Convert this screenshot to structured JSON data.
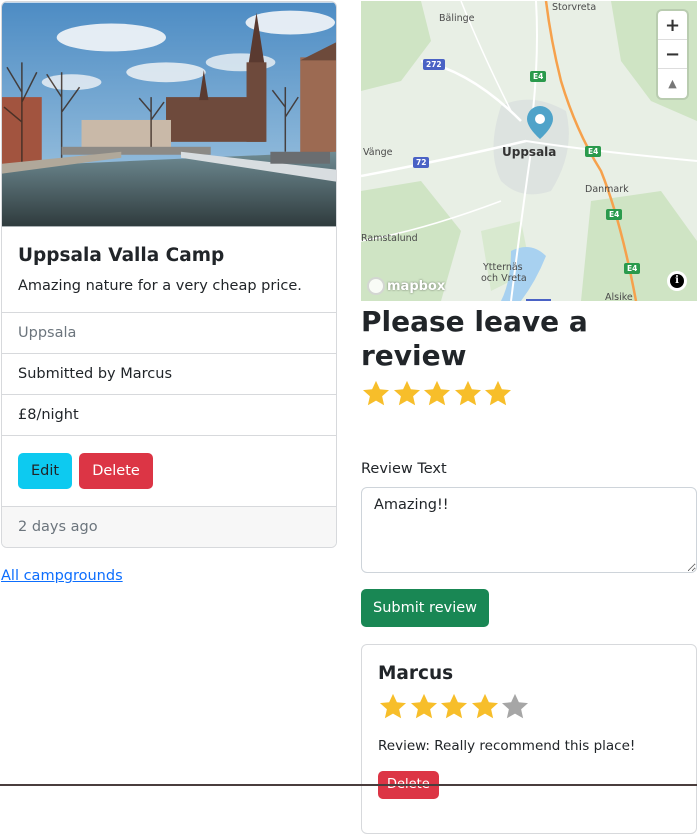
{
  "campground": {
    "title": "Uppsala Valla Camp",
    "description": "Amazing nature for a very cheap price.",
    "location": "Uppsala",
    "submitted_by": "Submitted by Marcus",
    "price": "£8/night",
    "edit_label": "Edit",
    "delete_label": "Delete",
    "posted": "2 days ago",
    "image_icon": "river-cathedral-photo"
  },
  "links": {
    "all_campgrounds": "All campgrounds"
  },
  "map": {
    "labels": {
      "balinge": "Bälinge",
      "storvreta": "Storvreta",
      "uppsala": "Uppsala",
      "vange": "Vänge",
      "danmark": "Danmark",
      "ramstalund": "Ramstalund",
      "ytternas": "Ytternäs",
      "och_vreta": "och Vreta",
      "alsike": "Alsike"
    },
    "routes": {
      "r272": "272",
      "r72": "72",
      "e4a": "E4",
      "e4b": "E4",
      "e4c": "E4",
      "e4d": "E4"
    },
    "zoom_in": "+",
    "zoom_out": "−",
    "compass": "▲",
    "logo": "mapbox",
    "info": "i",
    "colors": {
      "water": "#a8d1f0",
      "highway": "#f6a14c",
      "pin": "#4fa3c9",
      "land": "#e8efe5",
      "forest": "#cfe4c4"
    }
  },
  "review_form": {
    "title": "Please leave a review",
    "rating": 5,
    "max_rating": 5,
    "label": "Review Text",
    "textarea_value": "Amazing!!",
    "submit_label": "Submit review"
  },
  "reviews": [
    {
      "author": "Marcus",
      "rating": 4,
      "max_rating": 5,
      "text": "Review: Really recommend this place!",
      "delete_label": "Delete"
    }
  ],
  "colors": {
    "star_filled": "#f7be2a",
    "star_empty": "#a6a6a6",
    "success": "#198754",
    "danger": "#dc3545",
    "info": "#0dcaf0"
  }
}
